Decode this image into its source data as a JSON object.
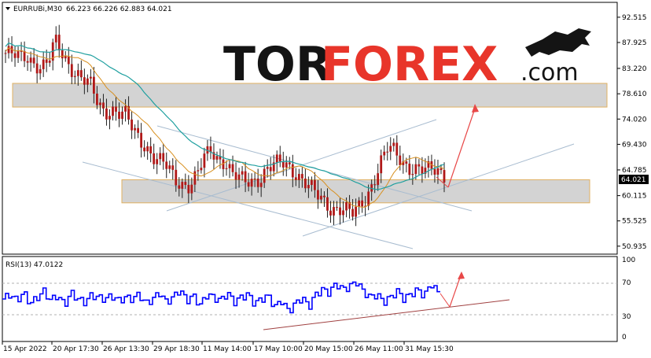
{
  "header": {
    "symbol": "EURRUBi,M30",
    "ohlc": "66.223 66.226 62.883 64.021"
  },
  "price_label": "64.021",
  "logo": {
    "part1": "TOR",
    "part2": "FOREX",
    "part3": ".com"
  },
  "rsi": {
    "title": "RSI(13) 47.0122",
    "levels": [
      "100",
      "70",
      "30",
      "0"
    ]
  },
  "colors": {
    "candle": "#b01818",
    "ma_fast": "#d89020",
    "ma_slow": "#20a0a0",
    "zone_fill": "#d3d3d3",
    "zone_border": "#e0b060",
    "channel": "#a8bcd0",
    "arrow": "#e84848",
    "rsi_line": "#0000ff",
    "rsi_trend": "#a04040"
  },
  "chart_data": [
    {
      "type": "candlestick",
      "title": "EURRUBi,M30",
      "y_ticks": [
        "92.515",
        "87.925",
        "83.220",
        "78.610",
        "74.020",
        "69.430",
        "64.785",
        "60.115",
        "55.525",
        "50.935"
      ],
      "x_ticks": [
        "15 Apr 2022",
        "20 Apr 17:30",
        "26 Apr 13:30",
        "29 Apr 18:30",
        "11 May 14:00",
        "17 May 10:00",
        "20 May 15:00",
        "26 May 11:00",
        "31 May 15:30"
      ],
      "ylim": [
        50.2,
        94.5
      ],
      "last_price": 64.021,
      "price_path": [
        86,
        85.5,
        85,
        85.5,
        84.5,
        83.5,
        84,
        88,
        86,
        84,
        82.5,
        81,
        80,
        77,
        75.5,
        76,
        75,
        74.5,
        72,
        70.5,
        69,
        67,
        66,
        65,
        63,
        62.5,
        62,
        63.5,
        66.5,
        68.5,
        67,
        66.5,
        64,
        63,
        62.5,
        63,
        63.5,
        65,
        65.5,
        66,
        65.5,
        64.5,
        63,
        61.5,
        60,
        59,
        58,
        58,
        57.5,
        56.5,
        58,
        60,
        63,
        66,
        68.5,
        68,
        66.5,
        65.5,
        65,
        64.5,
        64.5,
        65,
        64
      ],
      "support_zone": [
        58.8,
        63.0
      ],
      "resistance_zone": [
        76.2,
        80.5
      ]
    },
    {
      "type": "line",
      "title": "RSI(13) 47.0122",
      "ylim": [
        0,
        100
      ],
      "levels": [
        30,
        70
      ],
      "last_value": 47.0122,
      "values": [
        50,
        56,
        48,
        58,
        44,
        52,
        60,
        48,
        55,
        42,
        58,
        50,
        46,
        55,
        52,
        50,
        54,
        48,
        52,
        50,
        56,
        44,
        50,
        58,
        46,
        52,
        62,
        48,
        54,
        42,
        56,
        52,
        48,
        58,
        46,
        52,
        56,
        44,
        50,
        54,
        40,
        48,
        34,
        44,
        52,
        40,
        56,
        62,
        58,
        70,
        62,
        66,
        72,
        60,
        52,
        56,
        46,
        52,
        60,
        50,
        56,
        62,
        54,
        70,
        58
      ]
    }
  ]
}
